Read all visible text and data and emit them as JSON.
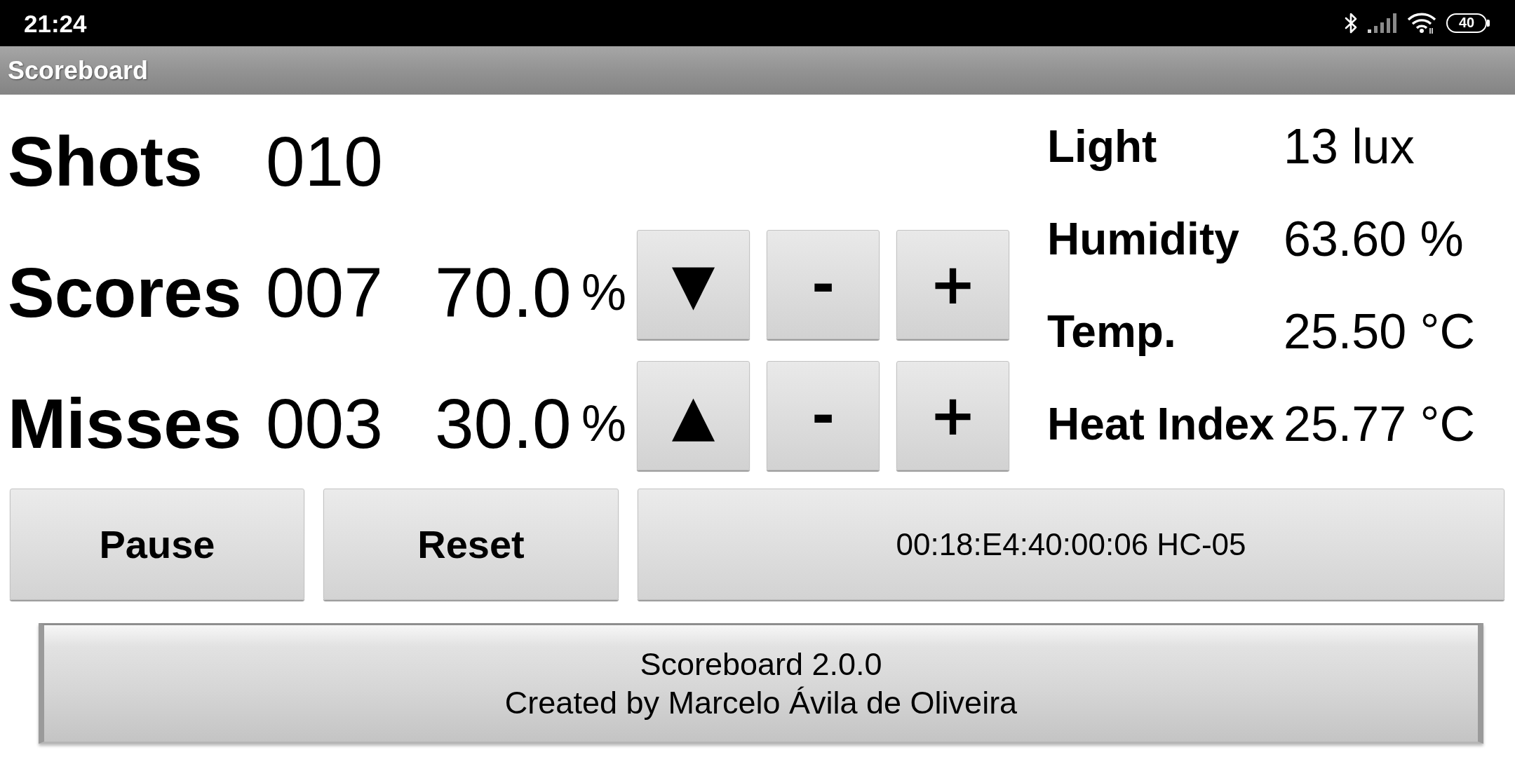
{
  "status_bar": {
    "time": "21:24",
    "battery": "40"
  },
  "title_bar": {
    "title": "Scoreboard"
  },
  "counters": [
    {
      "label": "Shots",
      "count": "010"
    },
    {
      "label": "Scores",
      "count": "007",
      "percent": "70.0",
      "unit": "%",
      "buttons": [
        "▼",
        "-",
        "+"
      ]
    },
    {
      "label": "Misses",
      "count": "003",
      "percent": "30.0",
      "unit": "%",
      "buttons": [
        "▲",
        "-",
        "+"
      ]
    }
  ],
  "sensors": [
    {
      "label": "Light",
      "value": "13 lux"
    },
    {
      "label": "Humidity",
      "value": "63.60 %"
    },
    {
      "label": "Temp.",
      "value": "25.50 °C"
    },
    {
      "label": "Heat Index",
      "value": "25.77 °C"
    }
  ],
  "actions": [
    {
      "kind": "command",
      "label": "Pause"
    },
    {
      "kind": "command",
      "label": "Reset"
    },
    {
      "kind": "device",
      "label": "00:18:E4:40:00:06 HC-05"
    }
  ],
  "footer": {
    "title": "Scoreboard 2.0.0",
    "credit": "Created by Marcelo Ávila de Oliveira"
  }
}
